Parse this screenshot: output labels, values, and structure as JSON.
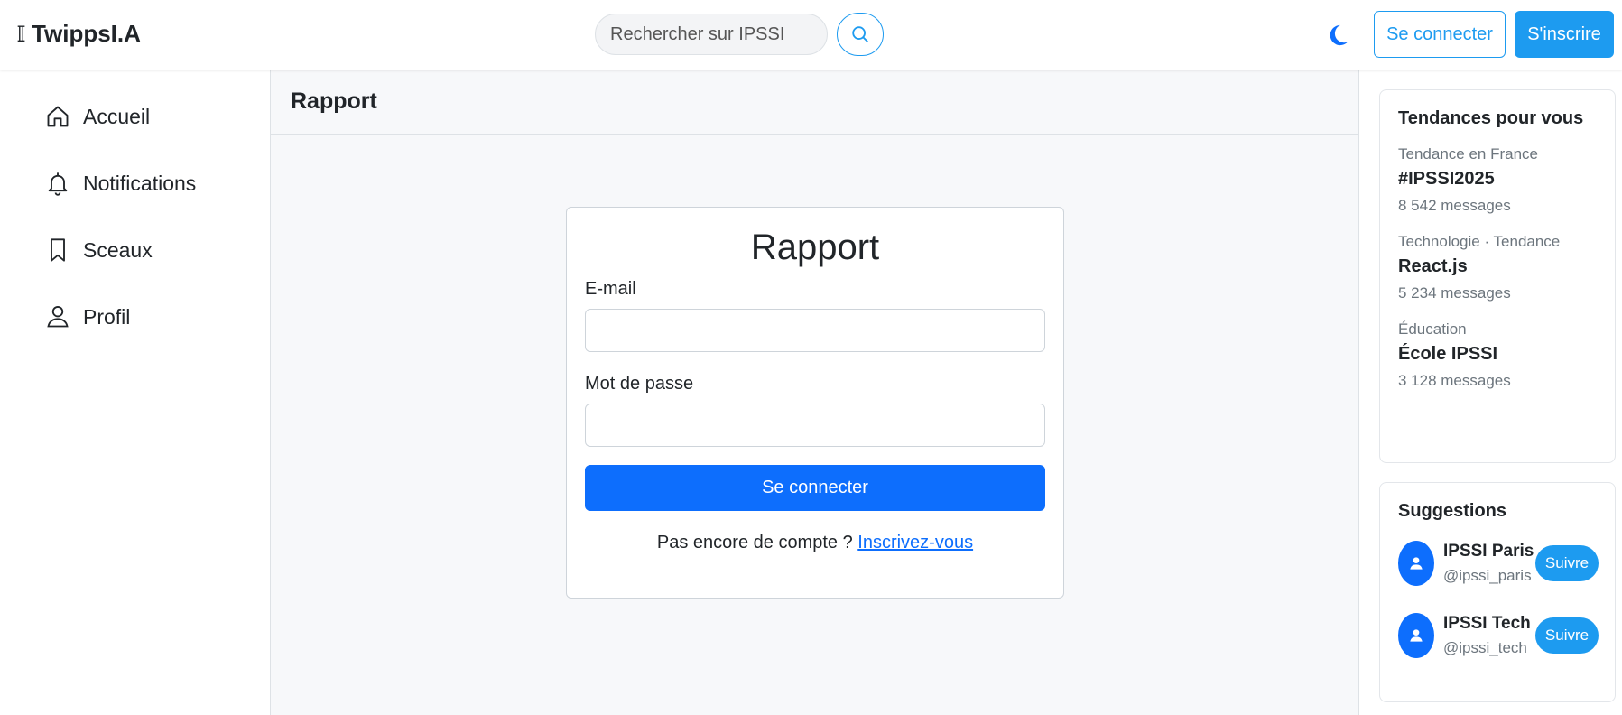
{
  "app": {
    "brand_icon": "𝕀",
    "brand": "TwippsI.A"
  },
  "navbar": {
    "search_placeholder": "Rechercher sur IPSSI",
    "login_label": "Se connecter",
    "signup_label": "S'inscrire"
  },
  "sidebar": {
    "items": [
      {
        "label": "Accueil",
        "icon": "home-icon"
      },
      {
        "label": "Notifications",
        "icon": "bell-icon"
      },
      {
        "label": "Sceaux",
        "icon": "bookmark-icon"
      },
      {
        "label": "Profil",
        "icon": "person-icon"
      }
    ]
  },
  "main": {
    "header_title": "Rapport",
    "form": {
      "title": "Rapport",
      "email_label": "E-mail",
      "email_value": "",
      "password_label": "Mot de passe",
      "password_value": "",
      "submit_label": "Se connecter",
      "signup_prompt": "Pas encore de compte ?",
      "signup_link": "Inscrivez-vous"
    }
  },
  "trends": {
    "title": "Tendances pour vous",
    "items": [
      {
        "category": "Tendance en France",
        "tag": "#IPSSI2025",
        "count": "8 542 messages"
      },
      {
        "category": "Technologie · Tendance",
        "tag": "React.js",
        "count": "5 234 messages"
      },
      {
        "category": "Éducation",
        "tag": "École IPSSI",
        "count": "3 128 messages"
      }
    ]
  },
  "suggestions": {
    "title": "Suggestions",
    "items": [
      {
        "name": "IPSSI Paris",
        "handle": "@ipssi_paris",
        "follow_label": "Suivre"
      },
      {
        "name": "IPSSI Tech",
        "handle": "@ipssi_tech",
        "follow_label": "Suivre"
      }
    ]
  },
  "colors": {
    "accent": "#1d9bf0",
    "primary_button": "#0d6efd"
  }
}
